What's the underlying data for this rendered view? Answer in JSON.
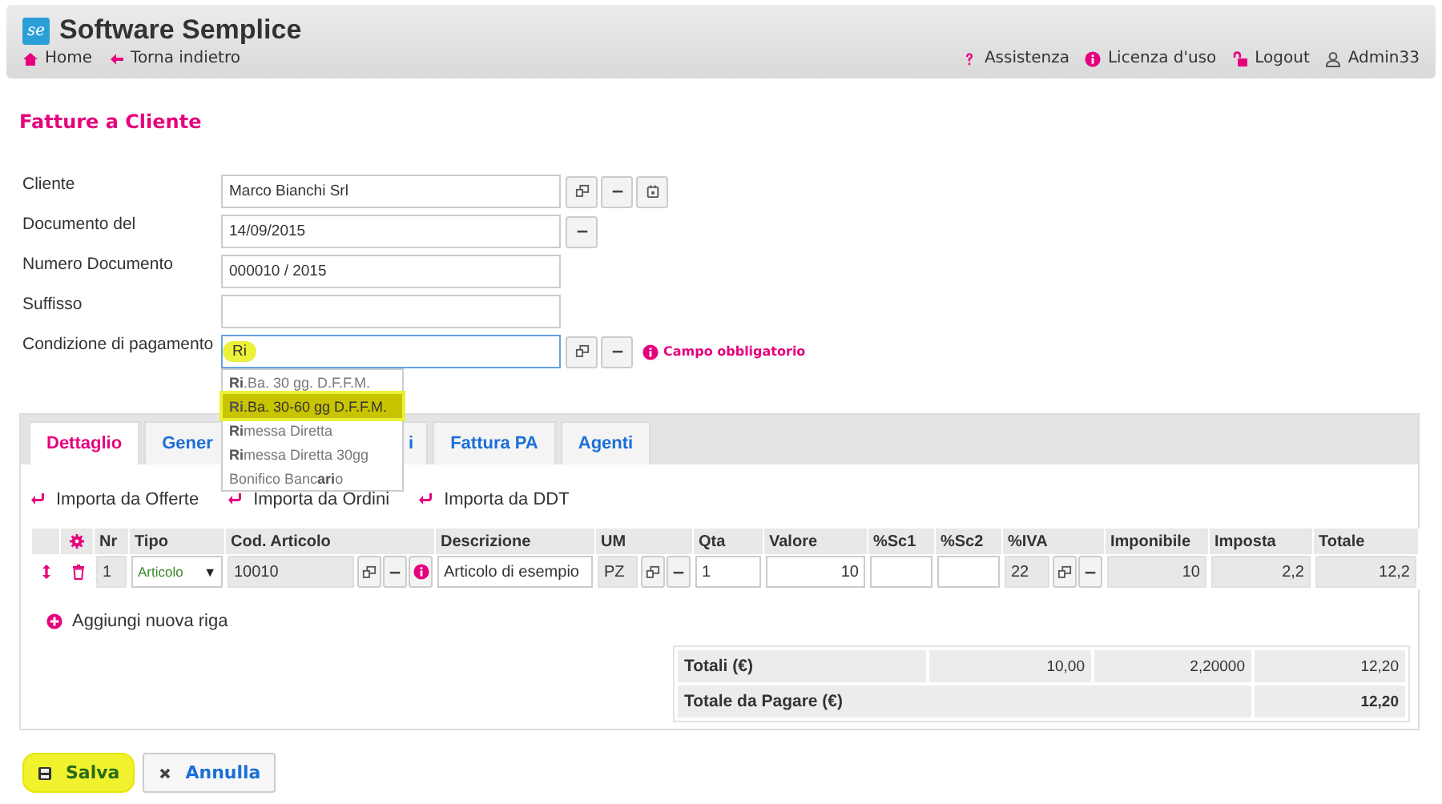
{
  "header": {
    "logo_text": "se",
    "app_title": "Software Semplice",
    "nav": [
      {
        "kind": "home",
        "label": "Home"
      },
      {
        "kind": "back",
        "label": "Torna indietro"
      }
    ],
    "user_menu": [
      {
        "kind": "help",
        "label": "Assistenza"
      },
      {
        "kind": "info",
        "label": "Licenza d'uso"
      },
      {
        "kind": "logout",
        "label": "Logout"
      },
      {
        "kind": "user",
        "label": "Admin33"
      }
    ]
  },
  "page_title": "Fatture a Cliente",
  "form": {
    "fields": [
      {
        "label": "Cliente",
        "value": "Marco Bianchi Srl",
        "highlighted": false,
        "focused": false,
        "buttons": [
          {
            "kind": "copy"
          },
          {
            "kind": "minus"
          },
          {
            "kind": "calendar"
          }
        ]
      },
      {
        "label": "Documento del",
        "value": "14/09/2015",
        "highlighted": false,
        "focused": false,
        "buttons": [
          {
            "kind": "minus"
          }
        ]
      },
      {
        "label": "Numero Documento",
        "value": "000010 / 2015",
        "highlighted": false,
        "focused": false
      },
      {
        "label": "Suffisso",
        "highlighted": false,
        "focused": false
      },
      {
        "label": "Condizione di pagamento",
        "value": "Ri",
        "highlighted": true,
        "focused": true,
        "buttons": [
          {
            "kind": "copy"
          },
          {
            "kind": "minus"
          }
        ],
        "required_note": "Campo obbligatorio",
        "suggestions": [
          {
            "text": "**Ri**.Ba. 30 gg. D.F.F.M.",
            "selected": false
          },
          {
            "text": "**Ri**.Ba. 30-60 gg D.F.F.M.",
            "selected": true
          },
          {
            "text": "**Ri**messa Diretta",
            "selected": false
          },
          {
            "text": "**Ri**messa Diretta 30gg",
            "selected": false
          },
          {
            "text": "Bonifico Banc**ari**o",
            "selected": false
          }
        ]
      }
    ]
  },
  "tabs": [
    {
      "label": "Dettaglio",
      "selected": true
    },
    {
      "label": "Gener",
      "selected": false
    },
    {
      "label": "i",
      "selected": false
    },
    {
      "label": "Fattura PA",
      "selected": false
    },
    {
      "label": "Agenti",
      "selected": false
    }
  ],
  "import_links": [
    {
      "label": "Importa da Offerte"
    },
    {
      "label": "Importa da Ordini"
    },
    {
      "label": "Importa da DDT"
    }
  ],
  "grid": {
    "columns": [
      {
        "label": "Nr"
      },
      {
        "label": "Tipo"
      },
      {
        "label": "Cod. Articolo"
      },
      {
        "label": "Descrizione"
      },
      {
        "label": "UM"
      },
      {
        "label": "Qta"
      },
      {
        "label": "Valore"
      },
      {
        "label": "%Sc1"
      },
      {
        "label": "%Sc2"
      },
      {
        "label": "%IVA"
      },
      {
        "label": "Imponibile"
      },
      {
        "label": "Imposta"
      },
      {
        "label": "Totale"
      }
    ],
    "rows": [
      {
        "cells": [
          {
            "kind": "readonly",
            "value": "1"
          },
          {
            "kind": "select",
            "value": "Articolo",
            "caret": "▼"
          },
          {
            "kind": "readonly",
            "value": "10010",
            "buttons": [
              {
                "kind": "copy"
              },
              {
                "kind": "minus"
              },
              {
                "kind": "info"
              }
            ]
          },
          {
            "kind": "input",
            "value": "Articolo di esempio"
          },
          {
            "kind": "readonly",
            "value": "PZ",
            "buttons": [
              {
                "kind": "copy"
              },
              {
                "kind": "minus"
              }
            ]
          },
          {
            "kind": "input",
            "value": "1"
          },
          {
            "kind": "number",
            "value": "10"
          },
          {
            "kind": "input"
          },
          {
            "kind": "input"
          },
          {
            "kind": "readonly",
            "value": "22",
            "buttons": [
              {
                "kind": "copy"
              },
              {
                "kind": "minus"
              }
            ]
          },
          {
            "kind": "readonly_number",
            "value": "10"
          },
          {
            "kind": "readonly_number",
            "value": "2,2"
          },
          {
            "kind": "readonly_number",
            "value": "12,2"
          }
        ]
      }
    ]
  },
  "add_row_link": "Aggiungi nuova riga",
  "totals": [
    {
      "label": "Totali (€)",
      "values": [
        "10,00",
        "2,20000",
        "12,20"
      ]
    },
    {
      "label": "Totale da Pagare (€)",
      "values": [
        "12,20"
      ]
    }
  ],
  "actions": [
    {
      "kind": "save",
      "label": "Salva",
      "highlighted": true
    },
    {
      "kind": "cancel",
      "label": "Annulla",
      "highlighted": false
    }
  ]
}
